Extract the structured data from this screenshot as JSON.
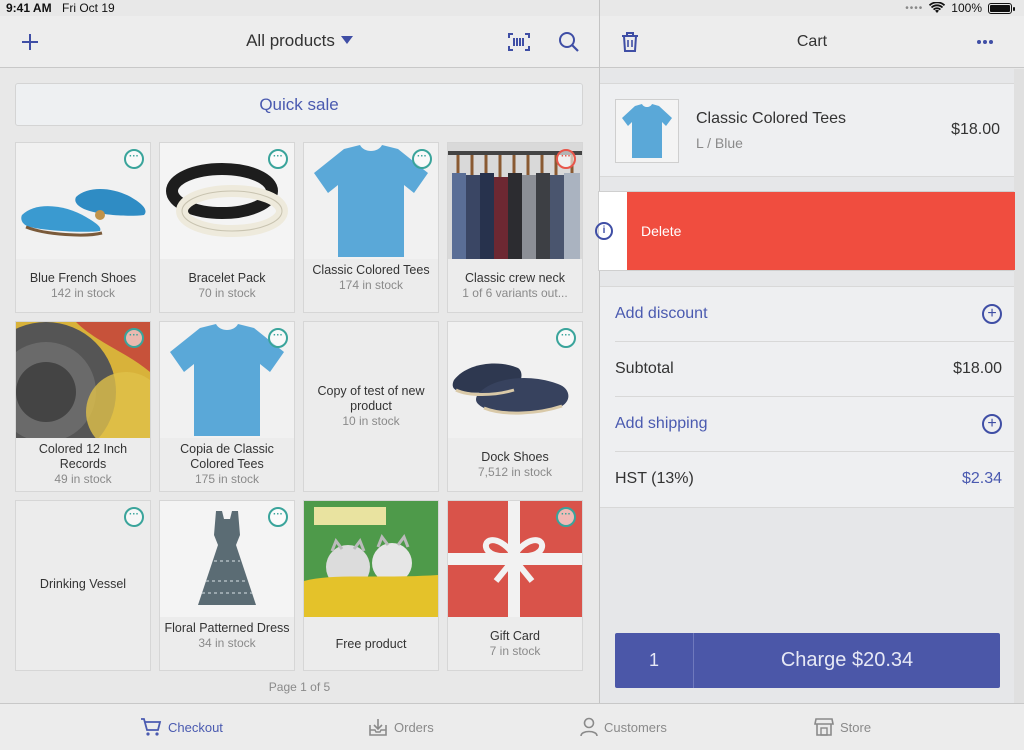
{
  "status_bar": {
    "time": "9:41 AM",
    "date": "Fri Oct 19",
    "dots": "••••",
    "battery": "100%"
  },
  "products_header": {
    "title": "All products",
    "add_icon": "plus-icon",
    "scan_icon": "barcode-scan-icon",
    "search_icon": "search-icon"
  },
  "quick_sale": "Quick sale",
  "products": [
    {
      "name": "Blue French Shoes",
      "stock": "142 in stock",
      "image": "shoes-image"
    },
    {
      "name": "Bracelet Pack",
      "stock": "70 in stock",
      "image": "bracelet-image"
    },
    {
      "name": "Classic Colored Tees",
      "stock": "174 in stock",
      "image": "tshirt-image"
    },
    {
      "name": "Classic crew neck",
      "stock": "1 of 6 variants out...",
      "image": "clothes-rack-image"
    },
    {
      "name": "Colored 12 Inch Records",
      "stock": "49 in stock",
      "image": "records-image"
    },
    {
      "name": "Copia de Classic Colored Tees",
      "stock": "175 in stock",
      "image": "tshirt-image"
    },
    {
      "name": "Copy of test of new product",
      "stock": "10 in stock",
      "image": ""
    },
    {
      "name": "Dock Shoes",
      "stock": "7,512 in stock",
      "image": "dock-shoes-image"
    },
    {
      "name": "Drinking Vessel",
      "stock": "",
      "image": ""
    },
    {
      "name": "Floral Patterned Dress",
      "stock": "34 in stock",
      "image": "dress-image"
    },
    {
      "name": "Free product",
      "stock": "",
      "image": "cats-book-image"
    },
    {
      "name": "Gift Card",
      "stock": "7 in stock",
      "image": "gift-card-image"
    }
  ],
  "pager": "Page 1 of 5",
  "cart": {
    "title": "Cart",
    "trash_icon": "trash-icon",
    "more_icon": "more-icon",
    "item": {
      "name": "Classic Colored Tees",
      "variant": "L / Blue",
      "price": "$18.00"
    },
    "delete_label": "Delete",
    "add_discount": "Add discount",
    "subtotal_label": "Subtotal",
    "subtotal_value": "$18.00",
    "add_shipping": "Add shipping",
    "tax_label": "HST (13%)",
    "tax_value": "$2.34",
    "quantity": "1",
    "charge_label": "Charge $20.34"
  },
  "tabs": [
    {
      "label": "Checkout",
      "icon": "cart-icon",
      "active": true
    },
    {
      "label": "Orders",
      "icon": "orders-icon",
      "active": false
    },
    {
      "label": "Customers",
      "icon": "person-icon",
      "active": false
    },
    {
      "label": "Store",
      "icon": "store-icon",
      "active": false
    }
  ],
  "colors": {
    "accent": "#4a5ab0",
    "delete": "#f04d3f",
    "teal": "#3aa49b"
  }
}
